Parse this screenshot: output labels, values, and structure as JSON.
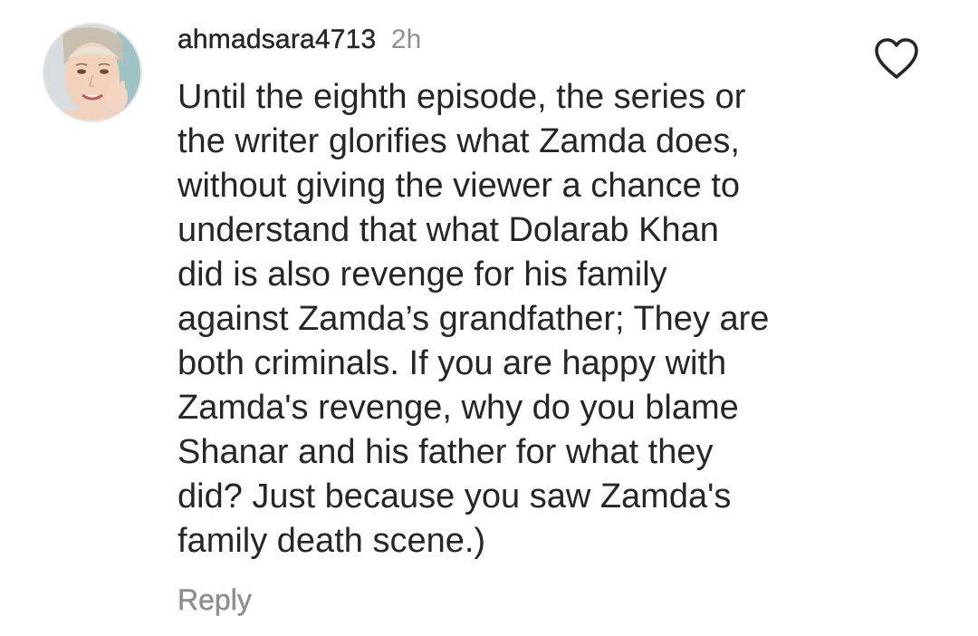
{
  "comment": {
    "username": "ahmadsara4713",
    "timestamp": "2h",
    "text_lines": [
      "Until the eighth episode, the series or",
      "the writer glorifies what Zamda does,",
      "without giving the viewer a chance to",
      "understand that what Dolarab Khan",
      "did is also revenge for his family",
      "against Zamda’s grandfather; They are",
      "both criminals. If you are happy with",
      "Zamda's revenge, why do you blame",
      "Shanar and his father for what they",
      "did? Just because you saw Zamda's",
      "family death scene.)"
    ],
    "reply_label": "Reply",
    "like_icon": "heart-outline-icon",
    "avatar_icon": "profile-avatar"
  },
  "colors": {
    "primary_text": "#262626",
    "secondary_text": "#8e8e8e",
    "background": "#ffffff"
  }
}
